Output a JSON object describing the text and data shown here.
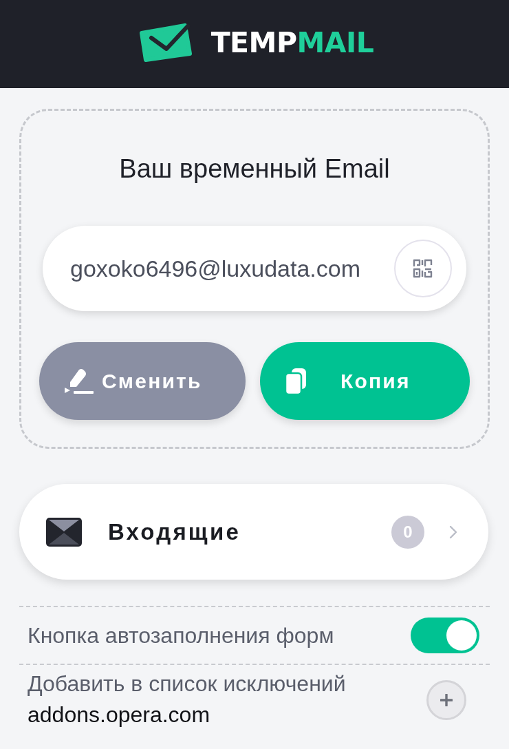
{
  "header": {
    "logo": {
      "text_1": "TEMP",
      "text_2": "MAIL"
    }
  },
  "email_card": {
    "title": "Ваш временный Email",
    "email": "goxoko6496@luxudata.com",
    "buttons": [
      {
        "label": "Сменить",
        "kind": "change"
      },
      {
        "label": "Копия",
        "kind": "copy"
      }
    ]
  },
  "inbox": {
    "label": "Входящие",
    "count": "0"
  },
  "settings": [
    {
      "kind": "toggle",
      "label": "Кнопка автозаполнения форм",
      "on": true
    },
    {
      "kind": "add",
      "label": "Добавить в список исключений",
      "value": "addons.opera.com"
    }
  ]
}
